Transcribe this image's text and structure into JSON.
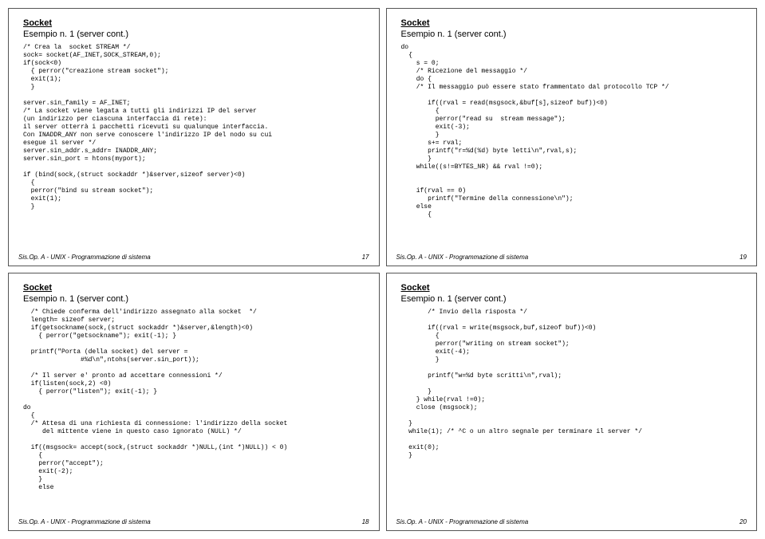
{
  "slides": [
    {
      "section": "Socket",
      "title": "Esempio n. 1 (server cont.)",
      "code": "/* Crea la  socket STREAM */\nsock= socket(AF_INET,SOCK_STREAM,0);\nif(sock<0)\n  { perror(\"creazione stream socket\");\n  exit(1);\n  }\n\nserver.sin_family = AF_INET;\n/* La socket viene legata a tutti gli indirizzi IP del server\n(un indirizzo per ciascuna interfaccia di rete):\nil server otterrà i pacchetti ricevuti su qualunque interfaccia.\nCon INADDR_ANY non serve conoscere l'indirizzo IP del nodo su cui\nesegue il server */\nserver.sin_addr.s_addr= INADDR_ANY;\nserver.sin_port = htons(myport);\n\nif (bind(sock,(struct sockaddr *)&server,sizeof server)<0)\n  {\n  perror(\"bind su stream socket\");\n  exit(1);\n  }",
      "footer": "Sis.Op. A - UNIX - Programmazione di sistema",
      "page": "17"
    },
    {
      "section": "Socket",
      "title": "Esempio n. 1 (server cont.)",
      "code": "do\n  {\n    s = 0;\n    /* Ricezione del messaggio */\n    do {\n    /* Il messaggio può essere stato frammentato dal protocollo TCP */\n\n       if((rval = read(msgsock,&buf[s],sizeof buf))<0)\n         {\n         perror(\"read su  stream message\");\n         exit(-3);\n         }\n       s+= rval;\n       printf(\"r=%d(%d) byte letti\\n\",rval,s);\n       }\n    while((s!=BYTES_NR) && rval !=0);\n\n\n    if(rval == 0)\n       printf(\"Termine della connessione\\n\");\n    else\n       {",
      "footer": "Sis.Op. A - UNIX - Programmazione di sistema",
      "page": "19"
    },
    {
      "section": "Socket",
      "title": "Esempio n. 1 (server cont.)",
      "code": "  /* Chiede conferma dell'indirizzo assegnato alla socket  */\n  length= sizeof server;\n  if(getsockname(sock,(struct sockaddr *)&server,&length)<0)\n    { perror(\"getsockname\"); exit(-1); }\n\n  printf(\"Porta (della socket) del server =\n               #%d\\n\",ntohs(server.sin_port));\n\n  /* Il server e' pronto ad accettare connessioni */\n  if(listen(sock,2) <0)\n    { perror(\"listen\"); exit(-1); }\n\ndo\n  {\n  /* Attesa di una richiesta di connessione: l'indirizzo della socket\n     del mittente viene in questo caso ignorato (NULL) */\n\n  if((msgsock= accept(sock,(struct sockaddr *)NULL,(int *)NULL)) < 0)\n    {\n    perror(\"accept\");\n    exit(-2);\n    }\n    else",
      "footer": "Sis.Op. A - UNIX - Programmazione di sistema",
      "page": "18"
    },
    {
      "section": "Socket",
      "title": "Esempio n. 1 (server cont.)",
      "code": "       /* Invio della risposta */\n\n       if((rval = write(msgsock,buf,sizeof buf))<0)\n         {\n         perror(\"writing on stream socket\");\n         exit(-4);\n         }\n\n       printf(\"w=%d byte scritti\\n\",rval);\n\n       }\n    } while(rval !=0);\n    close (msgsock);\n\n  }\n  while(1); /* ^C o un altro segnale per terminare il server */\n\n  exit(0);\n  }",
      "footer": "Sis.Op. A - UNIX - Programmazione di sistema",
      "page": "20"
    }
  ]
}
